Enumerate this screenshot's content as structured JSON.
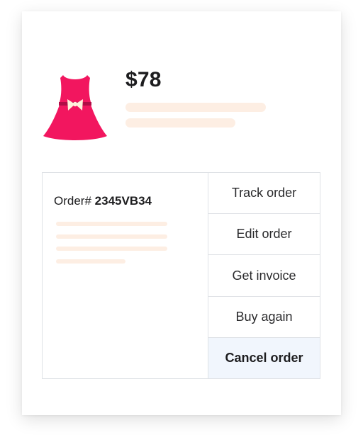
{
  "product": {
    "icon": "dress-icon",
    "price": "$78",
    "colors": {
      "dress": "#f2165f",
      "bow": "#fff1dc",
      "belt": "#b00d46",
      "placeholder": "#fdeee3"
    }
  },
  "order": {
    "label": "Order#",
    "number": "2345VB34"
  },
  "actions": {
    "track": "Track order",
    "edit": "Edit order",
    "invoice": "Get invoice",
    "buy_again": "Buy again",
    "cancel": "Cancel order"
  },
  "colors": {
    "cancel_bg": "#f1f6fd",
    "border": "#dfe2e6"
  }
}
